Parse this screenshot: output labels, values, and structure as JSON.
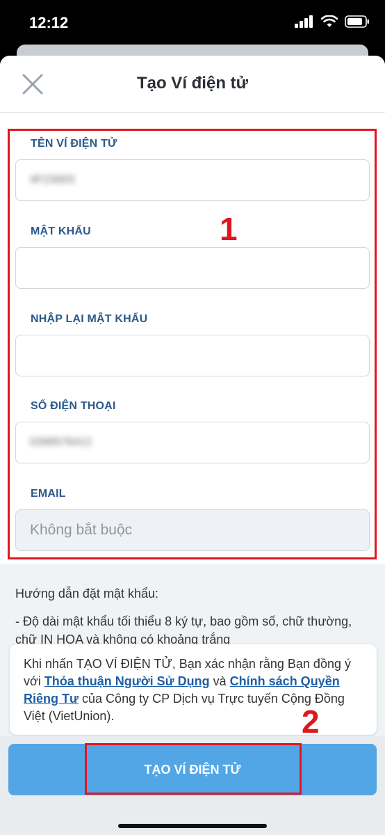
{
  "status_bar": {
    "time": "12:12"
  },
  "header": {
    "title": "Tạo Ví điện tử"
  },
  "form": {
    "fields": [
      {
        "label": "TÊN VÍ ĐIỆN TỬ",
        "value": "4F2300S"
      },
      {
        "label": "MẬT KHẨU",
        "value": ""
      },
      {
        "label": "NHẬP LẠI MẬT KHẨU",
        "value": ""
      },
      {
        "label": "SỐ ĐIỆN THOẠI",
        "value": "0398576412"
      },
      {
        "label": "EMAIL",
        "placeholder": "Không bắt buộc"
      }
    ]
  },
  "annotations": {
    "box1": "1",
    "box2": "2"
  },
  "guide": {
    "title": "Hướng dẫn đặt mật khẩu:",
    "line1": "- Độ dài mật khẩu tối thiểu 8 ký tự, bao gồm số, chữ thường, chữ IN HOA và không có khoảng trắng"
  },
  "consent": {
    "text_before": "Khi nhấn TẠO VÍ ĐIỆN TỬ, Bạn xác nhận rằng Bạn đồng ý với ",
    "link1": "Thỏa thuận Người Sử Dụng",
    "text_middle": " và ",
    "link2": "Chính sách Quyền Riêng Tư",
    "text_after": " của Công ty CP Dịch vụ Trực tuyến Cộng Đồng Việt (VietUnion)."
  },
  "submit": {
    "label": "TẠO VÍ ĐIỆN TỬ"
  },
  "colors": {
    "accent": "#53a6e6",
    "label": "#2a5a8c",
    "annotation": "#e0161e"
  }
}
